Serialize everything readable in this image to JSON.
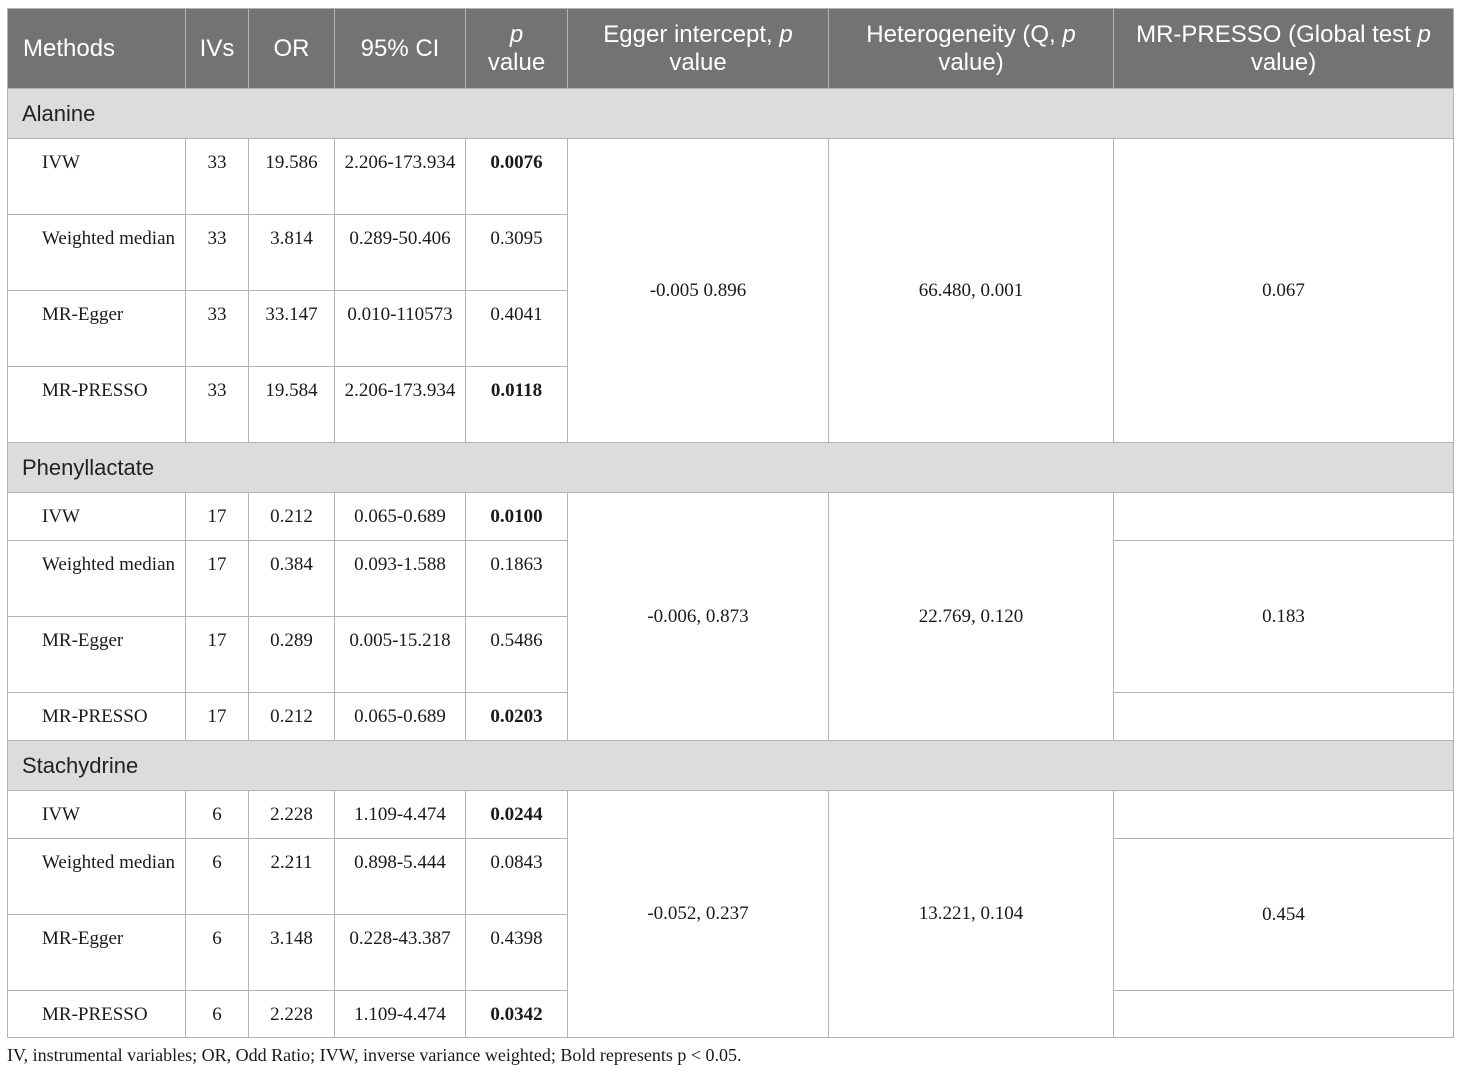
{
  "headers": {
    "methods": "Methods",
    "ivs": "IVs",
    "or": "OR",
    "ci": "95% CI",
    "p_italic": "p",
    "p_rest": "value",
    "egger_pre": "Egger intercept, ",
    "egger_italic": "p",
    "egger_post": "value",
    "het_pre": "Heterogeneity (Q, ",
    "het_italic": "p",
    "het_post": "value)",
    "presso_pre": "MR-PRESSO (Global test ",
    "presso_italic": "p",
    "presso_post": "value)"
  },
  "sections": [
    {
      "name": "Alanine",
      "egger": "-0.005 0.896",
      "heterogeneity": "66.480, 0.001",
      "presso_global": "0.067",
      "rows": [
        {
          "method": "IVW",
          "ivs": "33",
          "or": "19.586",
          "ci": "2.206-173.934",
          "p": "0.0076",
          "bold": true
        },
        {
          "method": "Weighted median",
          "ivs": "33",
          "or": "3.814",
          "ci": "0.289-50.406",
          "p": "0.3095",
          "bold": false
        },
        {
          "method": "MR-Egger",
          "ivs": "33",
          "or": "33.147",
          "ci": "0.010-110573",
          "p": "0.4041",
          "bold": false
        },
        {
          "method": "MR-PRESSO",
          "ivs": "33",
          "or": "19.584",
          "ci": "2.206-173.934",
          "p": "0.0118",
          "bold": true
        }
      ]
    },
    {
      "name": "Phenyllactate",
      "egger": "-0.006, 0.873",
      "heterogeneity": "22.769, 0.120",
      "presso_global": "0.183",
      "rows": [
        {
          "method": "IVW",
          "ivs": "17",
          "or": "0.212",
          "ci": "0.065-0.689",
          "p": "0.0100",
          "bold": true
        },
        {
          "method": "Weighted median",
          "ivs": "17",
          "or": "0.384",
          "ci": "0.093-1.588",
          "p": "0.1863",
          "bold": false
        },
        {
          "method": "MR-Egger",
          "ivs": "17",
          "or": "0.289",
          "ci": "0.005-15.218",
          "p": "0.5486",
          "bold": false
        },
        {
          "method": "MR-PRESSO",
          "ivs": "17",
          "or": "0.212",
          "ci": "0.065-0.689",
          "p": "0.0203",
          "bold": true
        }
      ]
    },
    {
      "name": "Stachydrine",
      "egger": "-0.052, 0.237",
      "heterogeneity": "13.221, 0.104",
      "presso_global": "0.454",
      "rows": [
        {
          "method": "IVW",
          "ivs": "6",
          "or": "2.228",
          "ci": "1.109-4.474",
          "p": "0.0244",
          "bold": true
        },
        {
          "method": "Weighted median",
          "ivs": "6",
          "or": "2.211",
          "ci": "0.898-5.444",
          "p": "0.0843",
          "bold": false
        },
        {
          "method": "MR-Egger",
          "ivs": "6",
          "or": "3.148",
          "ci": "0.228-43.387",
          "p": "0.4398",
          "bold": false
        },
        {
          "method": "MR-PRESSO",
          "ivs": "6",
          "or": "2.228",
          "ci": "1.109-4.474",
          "p": "0.0342",
          "bold": true
        }
      ]
    }
  ],
  "footnote": "IV, instrumental variables; OR, Odd Ratio; IVW, inverse variance weighted; Bold represents p < 0.05."
}
